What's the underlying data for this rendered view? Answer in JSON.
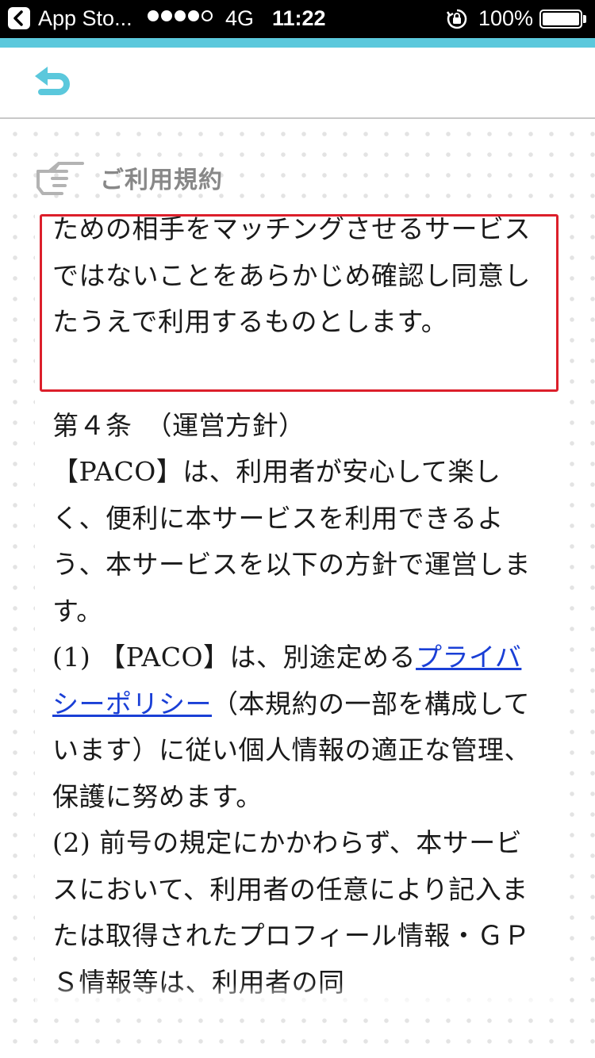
{
  "status_bar": {
    "app_name": "App Sto...",
    "signal_bars": 4,
    "network": "4G",
    "time": "11:22",
    "battery": "100%",
    "battery_level": 1.0
  },
  "header": {
    "back_icon": "return-arrow-icon"
  },
  "section": {
    "icon": "pointing-hand-icon",
    "title": "ご利用規約"
  },
  "content": {
    "highlighted_paragraph": "ための相手をマッチングさせるサービスではないことをあらかじめ確認し同意したうえで利用するものとします。",
    "article_heading": "第４条　（運営方針）",
    "article_intro": "【PACO】は、利用者が安心して楽しく、便利に本サービスを利用できるよう、本サービスを以下の方針で運営します。",
    "item1_prefix": "(1) 【PACO】は、別途定める",
    "item1_link": "プライバシーポリシー",
    "item1_suffix": "（本規約の一部を構成しています）に従い個人情報の適正な管理、保護に努めます。",
    "item2": "(2) 前号の規定にかかわらず、本サービスにおいて、利用者の任意により記入または取得されたプロフィール",
    "item2_cutoff": "情報・ＧＰＳ情報等は、利用者の同"
  },
  "colors": {
    "accent": "#5bc8dc",
    "highlight_border": "#dc1f2b",
    "link": "#1a3fd6",
    "heading_gray": "#888888"
  }
}
